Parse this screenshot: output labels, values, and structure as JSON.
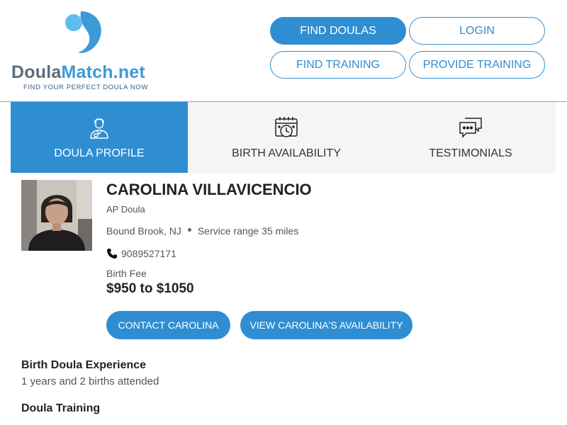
{
  "logo": {
    "name_part1": "Doula",
    "name_part2": "Match.net",
    "tagline": "FIND YOUR PERFECT DOULA NOW",
    "colors": {
      "primary": "#3d9ad6",
      "dark": "#5b6d7d"
    }
  },
  "nav": {
    "find_doulas": "FIND DOULAS",
    "login": "LOGIN",
    "find_training": "FIND TRAINING",
    "provide_training": "PROVIDE TRAINING"
  },
  "tabs": [
    {
      "label": "DOULA PROFILE",
      "icon": "doula-person-icon",
      "active": true
    },
    {
      "label": "BIRTH AVAILABILITY",
      "icon": "calendar-clock-icon",
      "active": false
    },
    {
      "label": "TESTIMONIALS",
      "icon": "chat-bubbles-icon",
      "active": false
    }
  ],
  "profile": {
    "name": "CAROLINA VILLAVICENCIO",
    "role": "AP Doula",
    "location": "Bound Brook, NJ",
    "service_range": "Service range 35 miles",
    "phone": "9089527171",
    "fee_label": "Birth Fee",
    "fee_value": "$950 to $1050",
    "contact_button": "CONTACT CAROLINA",
    "availability_button": "VIEW CAROLINA'S AVAILABILITY"
  },
  "sections": {
    "experience_title": "Birth Doula Experience",
    "experience_text": "1 years and 2 births attended",
    "training_title": "Doula Training"
  },
  "colors": {
    "accent": "#2f8ed1",
    "tab_bg": "#f5f5f5"
  }
}
